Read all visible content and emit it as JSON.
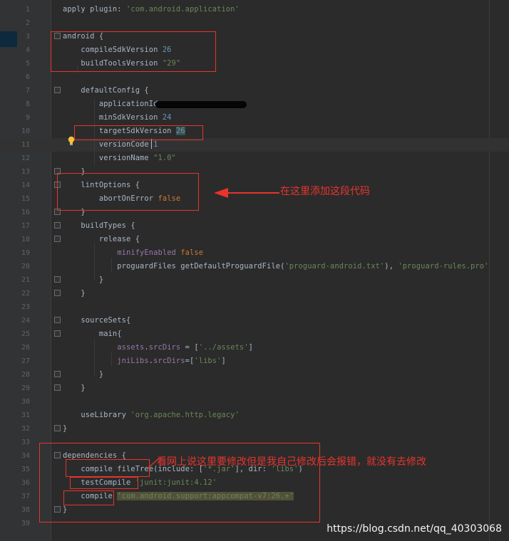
{
  "editor": {
    "lines": [
      {
        "n": "1",
        "html": "apply plugin: <span class='st'>'com.android.application'</span>"
      },
      {
        "n": "2",
        "html": ""
      },
      {
        "n": "3",
        "html": "android {"
      },
      {
        "n": "4",
        "html": "    compileSdkVersion <span class='nm'>26</span>"
      },
      {
        "n": "5",
        "html": "    buildToolsVersion <span class='st'>\"29\"</span>"
      },
      {
        "n": "6",
        "html": ""
      },
      {
        "n": "7",
        "html": "    defaultConfig {"
      },
      {
        "n": "8",
        "html": "        applicationId"
      },
      {
        "n": "9",
        "html": "        minSdkVersion <span class='nm'>24</span>"
      },
      {
        "n": "10",
        "html": "        targetSdkVersion <span class='nm hl-num'>26</span>"
      },
      {
        "n": "11",
        "html": "        versionCode <span class='nm'>1</span>"
      },
      {
        "n": "12",
        "html": "        versionName <span class='st'>\"1.0\"</span>"
      },
      {
        "n": "13",
        "html": "    }"
      },
      {
        "n": "14",
        "html": "    lintOptions {"
      },
      {
        "n": "15",
        "html": "        abortOnError <span class='kw'>false</span>"
      },
      {
        "n": "16",
        "html": "    }"
      },
      {
        "n": "17",
        "html": "    buildTypes {"
      },
      {
        "n": "18",
        "html": "        release {"
      },
      {
        "n": "19",
        "html": "            <span class='pr'>minifyEnabled</span> <span class='kw'>false</span>"
      },
      {
        "n": "20",
        "html": "            proguardFiles getDefaultProguardFile(<span class='st'>'proguard-android.txt'</span>), <span class='st'>'proguard-rules.pro'</span>"
      },
      {
        "n": "21",
        "html": "        }"
      },
      {
        "n": "22",
        "html": "    }"
      },
      {
        "n": "23",
        "html": ""
      },
      {
        "n": "24",
        "html": "    sourceSets{"
      },
      {
        "n": "25",
        "html": "        main{"
      },
      {
        "n": "26",
        "html": "            <span class='pr'>assets</span>.<span class='pr'>srcDirs</span> = [<span class='st'>'../assets'</span>]"
      },
      {
        "n": "27",
        "html": "            <span class='pr'>jniLibs</span>.<span class='pr'>srcDirs</span>=[<span class='st'>'libs'</span>]"
      },
      {
        "n": "28",
        "html": "        }"
      },
      {
        "n": "29",
        "html": "    }"
      },
      {
        "n": "30",
        "html": ""
      },
      {
        "n": "31",
        "html": "    useLibrary <span class='st'>'org.apache.http.legacy'</span>"
      },
      {
        "n": "32",
        "html": "}"
      },
      {
        "n": "33",
        "html": ""
      },
      {
        "n": "34",
        "html": "dependencies {"
      },
      {
        "n": "35",
        "html": "    compile fileTree(include: [<span class='st'>'*.jar'</span>], dir: <span class='st'>'libs'</span>)"
      },
      {
        "n": "36",
        "html": "    testCompile <span class='st'>'junit:junit:4.12'</span>"
      },
      {
        "n": "37",
        "html": "    compile <span class='st hl-str'>'com.android.support:appcompat-v7:26.+'</span>"
      },
      {
        "n": "38",
        "html": "}"
      },
      {
        "n": "39",
        "html": ""
      }
    ],
    "caret_line": "11"
  },
  "annotations": {
    "note_lint": "在这里添加这段代码",
    "note_deps": "看网上说这里要修改但是我自己修改后会报错，就没有去修改",
    "annotation_color": "#e8342d"
  },
  "watermark": "https://blog.csdn.net/qq_40303068",
  "colors": {
    "background": "#2b2b2b",
    "gutter": "#313335",
    "text": "#a9b7c6",
    "keyword": "#cc7832",
    "number": "#6897bb",
    "string": "#6a8759",
    "property": "#9876aa"
  }
}
